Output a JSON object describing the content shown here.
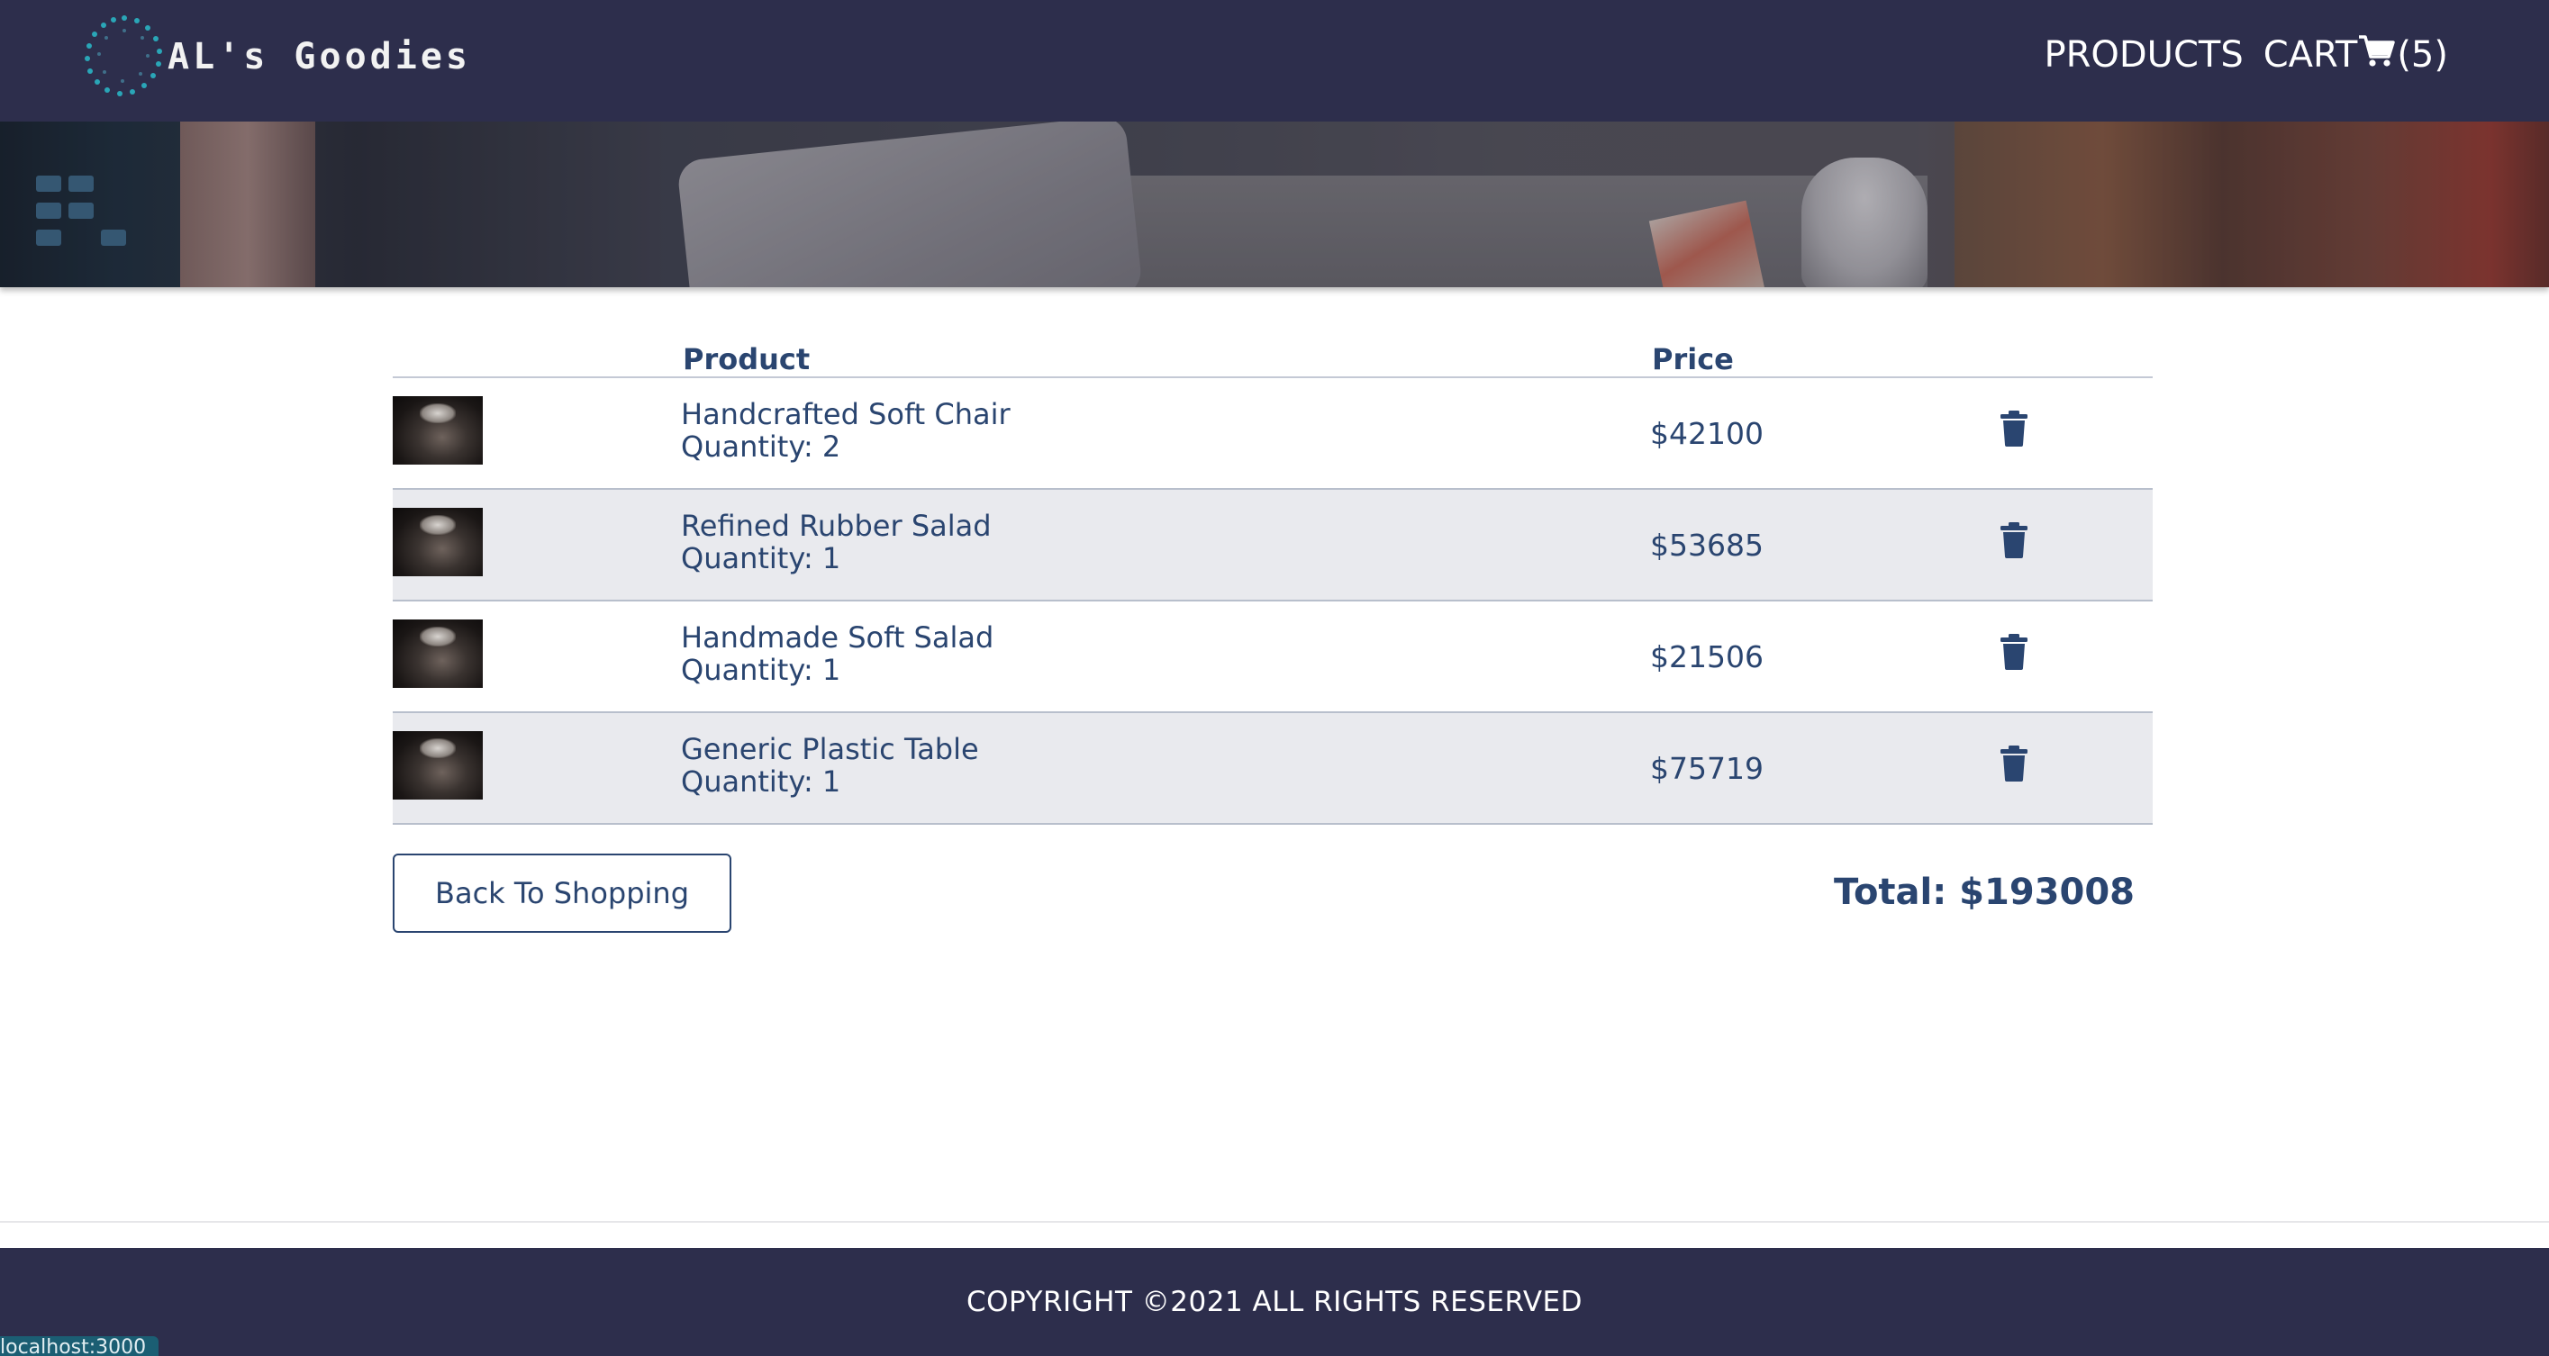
{
  "header": {
    "brand": "AL's Goodies",
    "logo_icon": "dotted-circle-logo",
    "nav": {
      "products_label": "PRODUCTS",
      "cart_label": "CART",
      "cart_count": "(5)",
      "cart_icon": "shopping-cart-icon"
    }
  },
  "cart": {
    "columns": {
      "product": "Product",
      "price": "Price"
    },
    "items": [
      {
        "name": "Handcrafted Soft Chair",
        "quantity": "Quantity: 2",
        "price": "$42100"
      },
      {
        "name": "Refined Rubber Salad",
        "quantity": "Quantity: 1",
        "price": "$53685"
      },
      {
        "name": "Handmade Soft Salad",
        "quantity": "Quantity: 1",
        "price": "$21506"
      },
      {
        "name": "Generic Plastic Table",
        "quantity": "Quantity: 1",
        "price": "$75719"
      }
    ],
    "delete_icon": "trash-icon",
    "back_label": "Back To Shopping",
    "total_label": "Total: $193008"
  },
  "footer": {
    "copyright": "COPYRIGHT ©2021 ALL RIGHTS RESERVED"
  },
  "statusbar": {
    "url": "localhost:3000"
  },
  "colors": {
    "header_bg": "#2d2e4c",
    "text_primary": "#2a4570",
    "row_alt": "#e9eaee",
    "logo_accent": "#2aa6b7"
  }
}
